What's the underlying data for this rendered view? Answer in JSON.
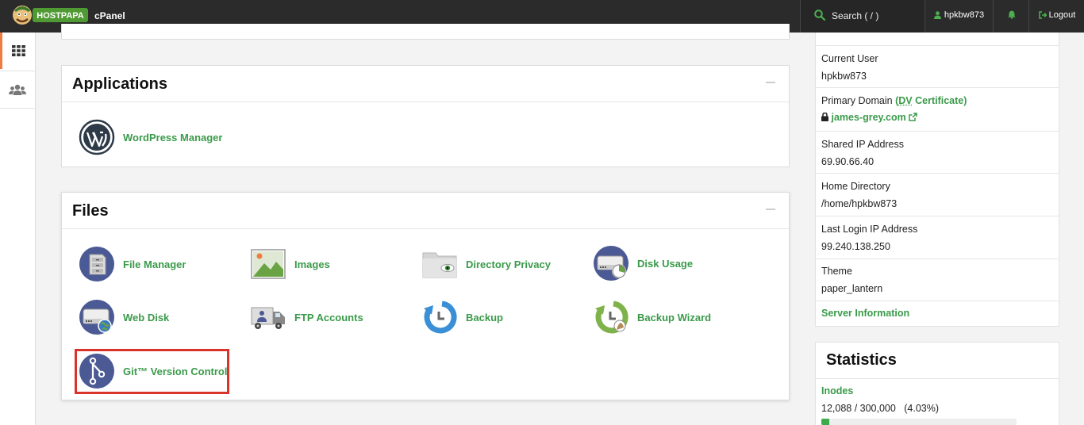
{
  "topbar": {
    "logo_text": "HOSTPAPA",
    "brand": "cPanel",
    "search_placeholder": "Search ( / )",
    "username": "hpkbw873",
    "logout_label": "Logout"
  },
  "applications": {
    "title": "Applications",
    "items": [
      {
        "label": "WordPress Manager",
        "icon": "wordpress-icon"
      }
    ]
  },
  "files": {
    "title": "Files",
    "items": [
      {
        "label": "File Manager",
        "icon": "file-manager-icon"
      },
      {
        "label": "Images",
        "icon": "images-icon"
      },
      {
        "label": "Directory Privacy",
        "icon": "directory-privacy-icon"
      },
      {
        "label": "Disk Usage",
        "icon": "disk-usage-icon"
      },
      {
        "label": "Web Disk",
        "icon": "web-disk-icon"
      },
      {
        "label": "FTP Accounts",
        "icon": "ftp-accounts-icon"
      },
      {
        "label": "Backup",
        "icon": "backup-icon"
      },
      {
        "label": "Backup Wizard",
        "icon": "backup-wizard-icon"
      },
      {
        "label": "Git™ Version Control",
        "icon": "git-icon"
      }
    ]
  },
  "info": {
    "current_user_label": "Current User",
    "current_user": "hpkbw873",
    "primary_domain_label": "Primary Domain",
    "certificate_open": "(",
    "certificate_abbr": "DV",
    "certificate_rest": " Certificate)",
    "primary_domain": "james-grey.com",
    "shared_ip_label": "Shared IP Address",
    "shared_ip": "69.90.66.40",
    "home_dir_label": "Home Directory",
    "home_dir": "/home/hpkbw873",
    "last_login_label": "Last Login IP Address",
    "last_login": "99.240.138.250",
    "theme_label": "Theme",
    "theme": "paper_lantern",
    "server_info_link": "Server Information"
  },
  "statistics": {
    "title": "Statistics",
    "inodes_label": "Inodes",
    "inodes_value": "12,088 / 300,000   (4.03%)",
    "inodes_percent": 4.03
  },
  "colors": {
    "link_green": "#3a9a4a",
    "topbar": "#2b2b2b",
    "active_rail": "#f07b3f",
    "highlight_red": "#d9332b"
  }
}
